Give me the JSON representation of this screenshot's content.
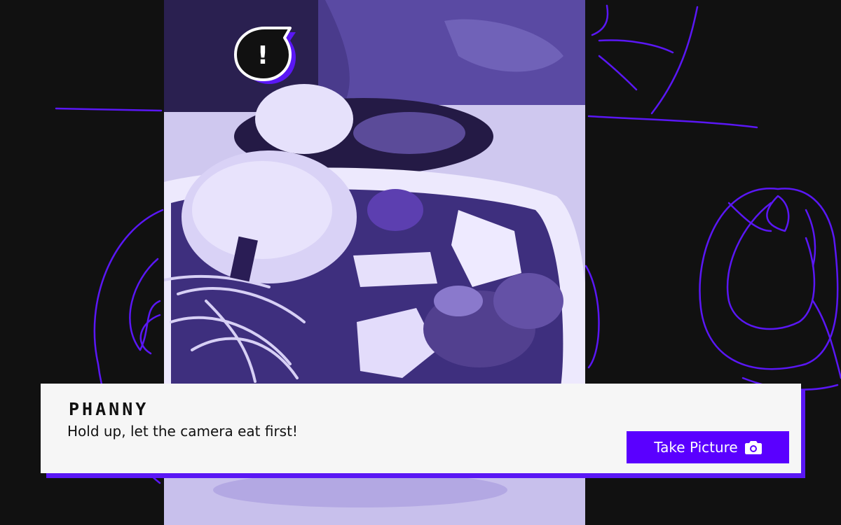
{
  "dialog": {
    "speaker": "PHANNY",
    "message": "Hold up, let the camera eat first!",
    "button_label": "Take Picture",
    "button_icon": "camera-icon"
  },
  "photo": {
    "subject": "plate of rice with sweet and sour stir-fry",
    "tint": "#5a17f5"
  },
  "alert": {
    "icon": "alert-bubble-icon",
    "symbol": "!"
  },
  "colors": {
    "accent": "#5a17f5",
    "background": "#111111",
    "dialog_bg": "#f6f6f6",
    "button_bg": "#5a00ff"
  }
}
